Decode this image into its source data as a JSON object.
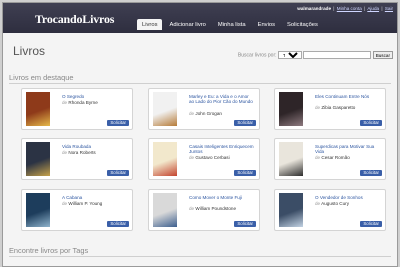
{
  "app": {
    "logo": "TrocandoLivros"
  },
  "user": {
    "name": "walmarandrade",
    "links": [
      "Minha conta",
      "Ajuda",
      "Sair"
    ]
  },
  "nav": {
    "tabs": [
      "Livros",
      "Adicionar livro",
      "Minha lista",
      "Envios",
      "Solicitações"
    ]
  },
  "page": {
    "title": "Livros"
  },
  "search": {
    "label": "Buscar livros por:",
    "option": "Título",
    "button": "Buscar"
  },
  "sections": {
    "featured": "Livros em destaque",
    "tags": "Encontre livros por Tags"
  },
  "labels": {
    "by": "de",
    "request": "Solicitar"
  },
  "books": [
    {
      "title": "O Segredo",
      "author": "Rhonda Byrne",
      "cover": "#8e3a1a",
      "accent": "#e6b94a"
    },
    {
      "title": "Marley e Eu: a Vida e o Amor ao Lado do Pior Cão do Mundo",
      "author": "John Grogan",
      "cover": "#f1f1f1",
      "accent": "#b67b38"
    },
    {
      "title": "Eles Continuam Entre Nós",
      "author": "Zibia Gasparetto",
      "cover": "#2e2528",
      "accent": "#8e7a7f"
    },
    {
      "title": "Vida Roubada",
      "author": "Nora Roberts",
      "cover": "#2b3344",
      "accent": "#c6a24a"
    },
    {
      "title": "Casais Inteligentes Enriquecem Juntos",
      "author": "Gustavo Cerbasi",
      "cover": "#f2e8cc",
      "accent": "#c4442e"
    },
    {
      "title": "Superdicas para Motivar Sua Vida",
      "author": "Cesar Romão",
      "cover": "#e9e5dc",
      "accent": "#2d2d2d"
    },
    {
      "title": "A Cabana",
      "author": "William P. Young",
      "cover": "#1d3d5c",
      "accent": "#8fb3cc"
    },
    {
      "title": "Como Mover o Monte Fuji",
      "author": "William Poundstone",
      "cover": "#d9d9d9",
      "accent": "#3d5f8e"
    },
    {
      "title": "O Vendedor de Sonhos",
      "author": "Augusto Cury",
      "cover": "#3b4d66",
      "accent": "#c2d2e3"
    }
  ]
}
